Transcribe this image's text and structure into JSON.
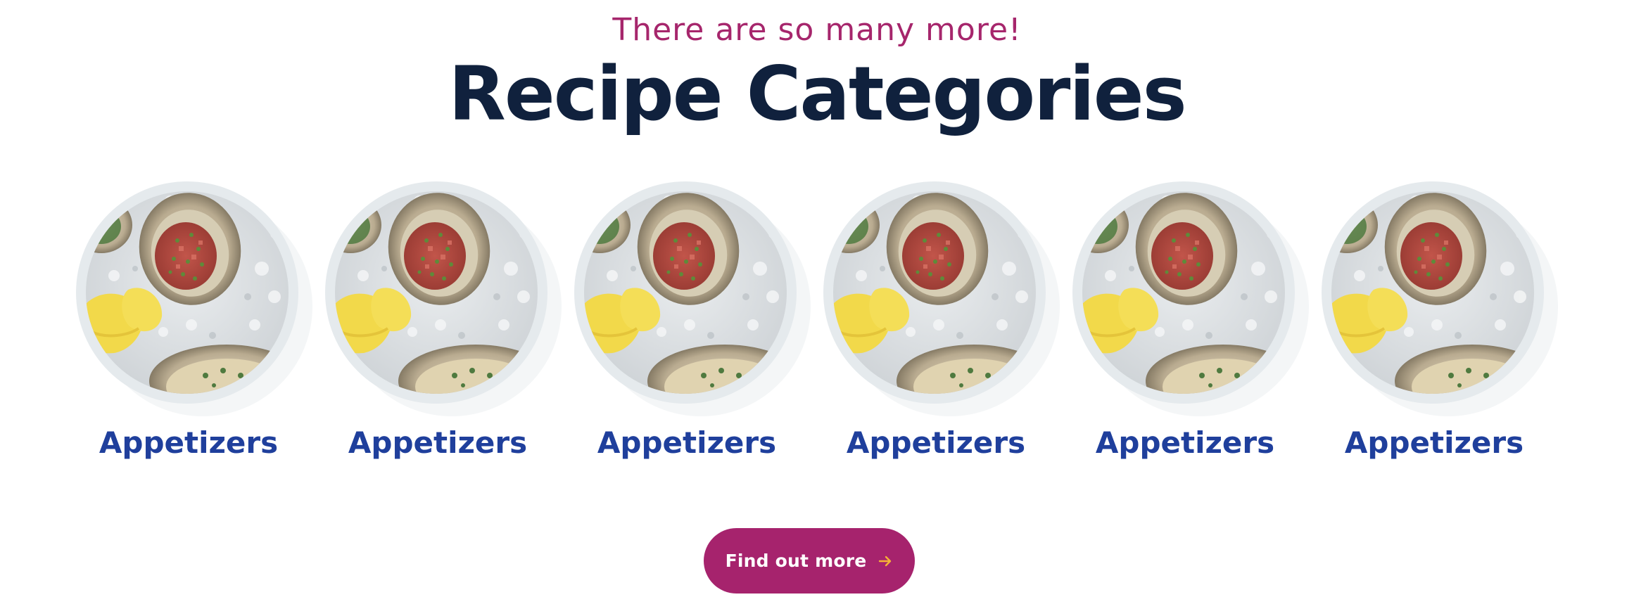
{
  "section": {
    "eyebrow": "There are so many more!",
    "heading": "Recipe Categories"
  },
  "categories": [
    {
      "label": "Appetizers",
      "image": "oysters-on-ice-with-lemon"
    },
    {
      "label": "Appetizers",
      "image": "oysters-on-ice-with-lemon"
    },
    {
      "label": "Appetizers",
      "image": "oysters-on-ice-with-lemon"
    },
    {
      "label": "Appetizers",
      "image": "oysters-on-ice-with-lemon"
    },
    {
      "label": "Appetizers",
      "image": "oysters-on-ice-with-lemon"
    },
    {
      "label": "Appetizers",
      "image": "oysters-on-ice-with-lemon"
    }
  ],
  "cta": {
    "label": "Find out more",
    "icon": "arrow-right-icon"
  },
  "colors": {
    "accent": "#a6236d",
    "heading": "#10213d",
    "category_label": "#1f3f9c",
    "arrow": "#f5b335"
  }
}
